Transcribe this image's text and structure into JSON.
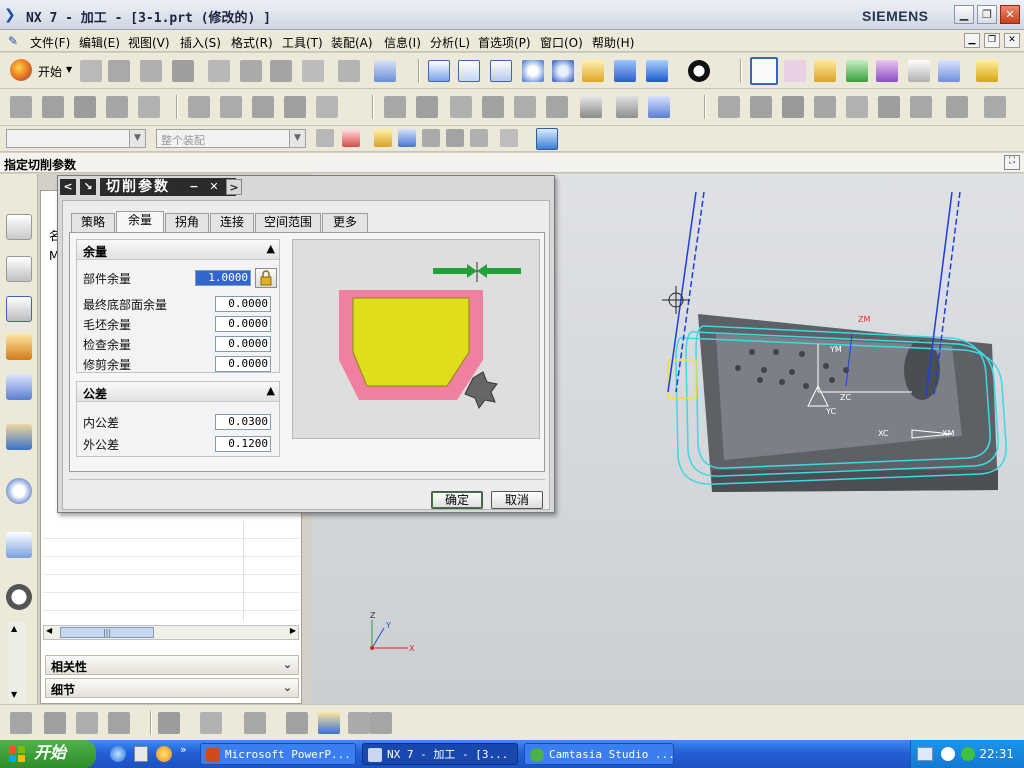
{
  "window": {
    "title": "NX 7 - 加工 - [3-1.prt  (修改的) ]",
    "brand": "SIEMENS"
  },
  "menu": {
    "items": [
      "文件(F)",
      "编辑(E)",
      "视图(V)",
      "插入(S)",
      "格式(R)",
      "工具(T)",
      "装配(A)",
      "信息(I)",
      "分析(L)",
      "首选项(P)",
      "窗口(O)",
      "帮助(H)"
    ]
  },
  "toolbar": {
    "start_label": "开始"
  },
  "selection_bar": {
    "filter_placeholder": "",
    "scope_value": "整个装配"
  },
  "cue_line": {
    "text": "指定切削参数"
  },
  "navigator": {
    "sections": [
      {
        "label": "相关性"
      },
      {
        "label": "细节"
      }
    ],
    "partial_labels": [
      "名",
      "M"
    ]
  },
  "dialog": {
    "title": "切削参数",
    "tabs": [
      {
        "label": "策略",
        "active": false
      },
      {
        "label": "余量",
        "active": true
      },
      {
        "label": "拐角",
        "active": false
      },
      {
        "label": "连接",
        "active": false
      },
      {
        "label": "空间范围",
        "active": false
      },
      {
        "label": "更多",
        "active": false
      }
    ],
    "stock_group": {
      "header": "余量",
      "fields": [
        {
          "label": "部件余量",
          "value": "1.0000"
        },
        {
          "label": "最终底部面余量",
          "value": "0.0000"
        },
        {
          "label": "毛坯余量",
          "value": "0.0000"
        },
        {
          "label": "检查余量",
          "value": "0.0000"
        },
        {
          "label": "修剪余量",
          "value": "0.0000"
        }
      ]
    },
    "tolerance_group": {
      "header": "公差",
      "fields": [
        {
          "label": "内公差",
          "value": "0.0300"
        },
        {
          "label": "外公差",
          "value": "0.1200"
        }
      ]
    },
    "ok_label": "确定",
    "cancel_label": "取消"
  },
  "viewport": {
    "axis_labels": {
      "x": "X",
      "y": "Y",
      "z": "Z"
    },
    "wcs_labels": {
      "xm": "XM",
      "ym": "YM",
      "zm": "ZM",
      "xc": "XC",
      "yc": "YC",
      "zc": "ZC"
    }
  },
  "taskbar": {
    "start_label": "开始",
    "tasks": [
      {
        "label": "Microsoft PowerP...",
        "active": false
      },
      {
        "label": "NX 7 - 加工 - [3...",
        "active": true
      },
      {
        "label": "Camtasia Studio ...",
        "active": false
      }
    ],
    "clock": "22:31"
  },
  "colors": {
    "toolpath_cyan": "#3fd8e0",
    "tool_axis_blue": "#1a3fe0",
    "part_gray": "#5d6166",
    "pink_stock": "#f07fa0",
    "yellow_part": "#dede1c",
    "arrow_green": "#22a13a"
  }
}
